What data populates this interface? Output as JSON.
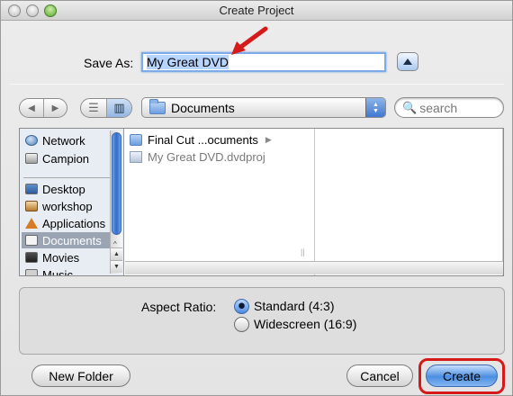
{
  "window": {
    "title": "Create Project"
  },
  "save_as": {
    "label": "Save As:",
    "value": "My Great DVD"
  },
  "toolbar": {
    "back_glyph": "◀",
    "forward_glyph": "▶",
    "list_glyph": "☰",
    "column_glyph": "▥",
    "location": "Documents",
    "search_placeholder": "search"
  },
  "sidebar": {
    "items": [
      {
        "label": "Network",
        "icon": "network-icon"
      },
      {
        "label": "Campion",
        "icon": "disk-icon"
      },
      {
        "label": "Desktop",
        "icon": "desktop-icon"
      },
      {
        "label": "workshop",
        "icon": "home-icon"
      },
      {
        "label": "Applications",
        "icon": "applications-icon"
      },
      {
        "label": "Documents",
        "icon": "documents-icon",
        "selected": true
      },
      {
        "label": "Movies",
        "icon": "movies-icon"
      },
      {
        "label": "Music",
        "icon": "music-icon"
      }
    ]
  },
  "files": [
    {
      "label": "Final Cut ...ocuments",
      "type": "folder"
    },
    {
      "label": "My Great DVD.dvdproj",
      "type": "project"
    }
  ],
  "aspect": {
    "label": "Aspect Ratio:",
    "options": [
      {
        "label": "Standard (4:3)",
        "checked": true
      },
      {
        "label": "Widescreen (16:9)",
        "checked": false
      }
    ]
  },
  "buttons": {
    "new_folder": "New Folder",
    "cancel": "Cancel",
    "create": "Create"
  },
  "colors": {
    "accent": "#4b8fe2",
    "annotation": "#d61a1a"
  }
}
